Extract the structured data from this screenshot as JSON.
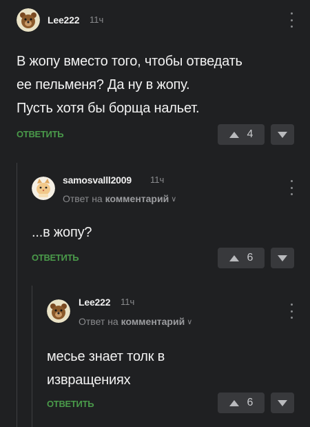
{
  "comments": [
    {
      "username": "Lee222",
      "time": "11ч",
      "lines": [
        "В жопу вместо того, чтобы отведать",
        "ее пельменя? Да ну в жопу.",
        "Пусть хотя бы борща нальет."
      ],
      "reply_label": "ОТВЕТИТЬ",
      "votes": "4",
      "avatar_icon": "bear-avatar-icon"
    },
    {
      "username": "samosvalll2009",
      "time": "11ч",
      "reply_prefix": "Ответ на",
      "reply_target": "комментарий",
      "lines": [
        "...в жопу?"
      ],
      "reply_label": "ОТВЕТИТЬ",
      "votes": "6",
      "avatar_icon": "cat-avatar-icon"
    },
    {
      "username": "Lee222",
      "time": "11ч",
      "reply_prefix": "Ответ на",
      "reply_target": "комментарий",
      "lines": [
        "месье знает толк в",
        "извращениях"
      ],
      "reply_label": "ОТВЕТИТЬ",
      "votes": "6",
      "avatar_icon": "bear-avatar-icon"
    }
  ],
  "colors": {
    "background": "#1f2022",
    "reply_link": "#4a9a4a",
    "vote_button": "#38393c"
  }
}
